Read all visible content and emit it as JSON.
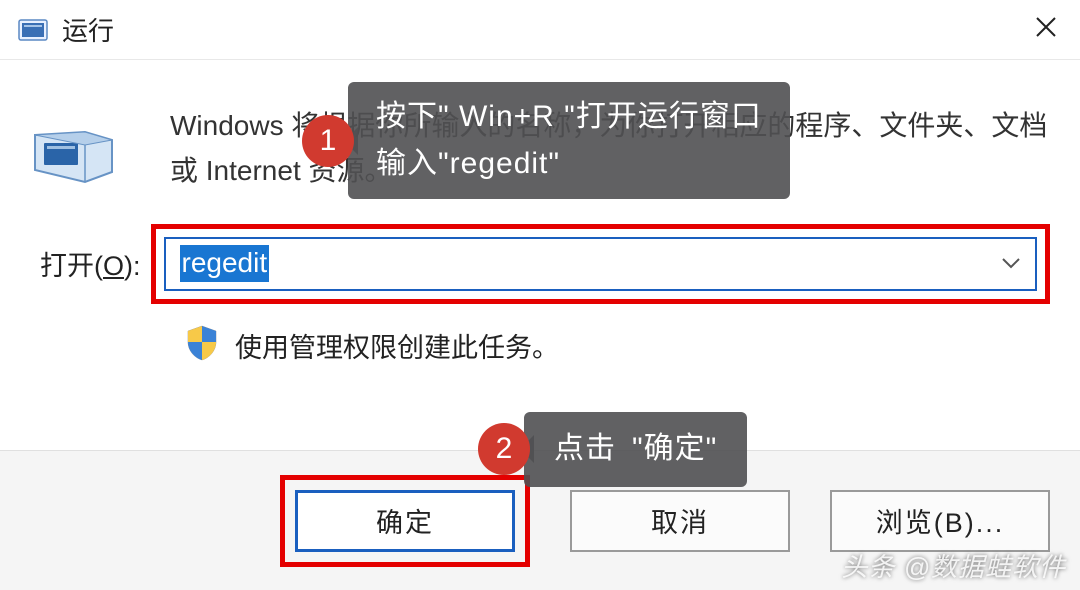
{
  "titlebar": {
    "title": "运行"
  },
  "content": {
    "description": "Windows 将根据你所输入的名称，为你打开相应的程序、文件夹、文档或 Internet 资源。",
    "open_label_pre": "打开(",
    "open_label_u": "O",
    "open_label_post": "):",
    "input_value": "regedit",
    "admin_note": "使用管理权限创建此任务。"
  },
  "buttons": {
    "ok": "确定",
    "cancel": "取消",
    "browse": "浏览(B)..."
  },
  "callouts": {
    "one_num": "1",
    "one_line1": "按下\" Win+R \"打开运行窗口",
    "one_line2": "输入\"regedit\"",
    "two_num": "2",
    "two_text": "点击 \"确定\""
  },
  "watermark": "头条 @数据蛙软件"
}
